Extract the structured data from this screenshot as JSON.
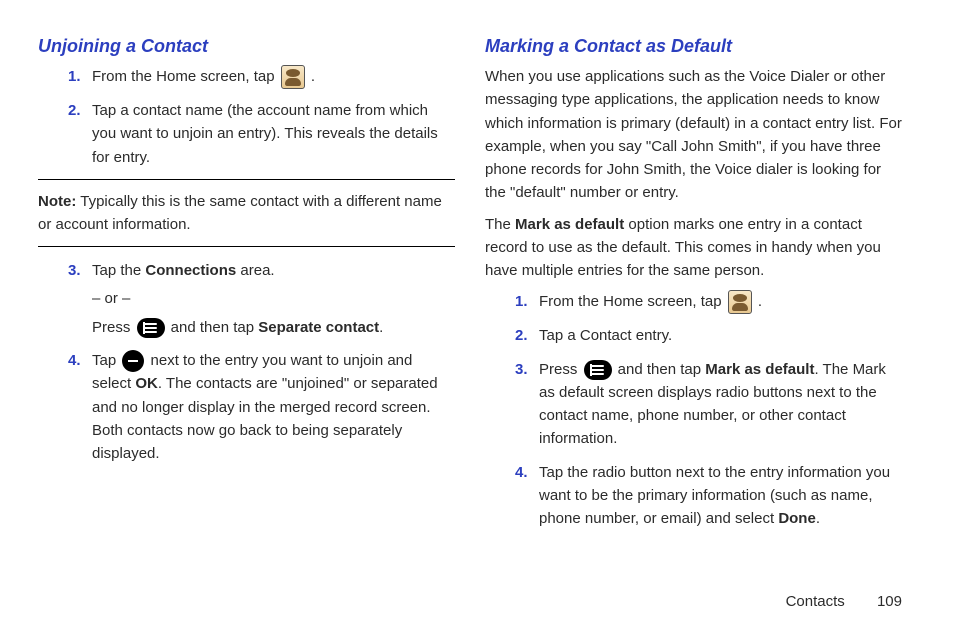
{
  "left": {
    "heading": "Unjoining a Contact",
    "steps_a": [
      {
        "pre": "From the Home screen, tap ",
        "icon": "contacts-icon",
        "post": " ."
      },
      {
        "text": "Tap a contact name (the account name from which you want to unjoin an entry). This reveals the details for entry."
      }
    ],
    "note_label": "Note:",
    "note_text": "Typically this is the same contact with a different name or account information.",
    "steps_b": [
      {
        "line1_pre": "Tap the ",
        "line1_bold": "Connections",
        "line1_post": " area.",
        "or_line": "– or –",
        "line2_pre": "Press ",
        "line2_icon": "menu-icon",
        "line2_mid": " and then tap ",
        "line2_bold": "Separate contact",
        "line2_post": "."
      },
      {
        "pre": "Tap ",
        "icon": "remove-icon",
        "mid": " next to the entry you want to unjoin and select ",
        "bold": "OK",
        "post": ". The contacts are \"unjoined\" or separated and no longer display in the merged record screen. Both contacts now go back to being separately displayed."
      }
    ]
  },
  "right": {
    "heading": "Marking a Contact as Default",
    "para1": "When you use applications such as the Voice Dialer or other messaging type applications, the application needs to know which information is primary (default) in a contact entry list. For example, when you say \"Call John Smith\", if you have three phone records for John Smith, the Voice dialer is looking for the \"default\" number or entry.",
    "para2_pre": "The ",
    "para2_bold": "Mark as default",
    "para2_post": " option marks one entry in a contact record to use as the default. This comes in handy when you have multiple entries for the same person.",
    "steps": [
      {
        "pre": "From the Home screen, tap ",
        "icon": "contacts-icon",
        "post": " ."
      },
      {
        "text": "Tap a Contact entry."
      },
      {
        "pre": "Press ",
        "icon": "menu-icon",
        "mid": " and then tap ",
        "bold": "Mark as default",
        "post": ". The Mark as default screen displays radio buttons next to the contact name, phone number, or other contact information."
      },
      {
        "pre": "Tap the radio button next to the entry information you want to be the primary information (such as name, phone number, or email) and select ",
        "bold": "Done",
        "post": "."
      }
    ]
  },
  "footer": {
    "section": "Contacts",
    "page": "109"
  }
}
